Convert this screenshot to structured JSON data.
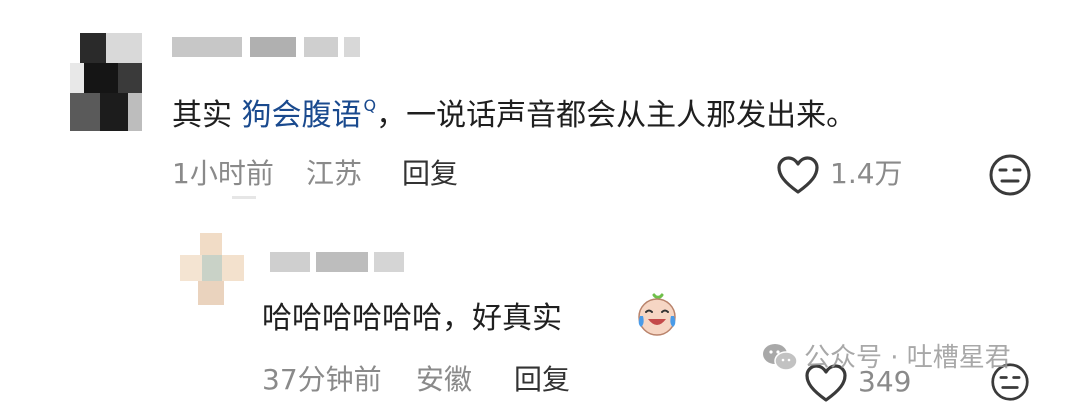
{
  "comment": {
    "prefix": "其实",
    "keyword": "狗会腹语",
    "keyword_marker": "Q",
    "suffix": "，一说话声音都会从主人那发出来。",
    "time": "1小时前",
    "location": "江苏",
    "reply_label": "回复",
    "like_count": "1.4万"
  },
  "reply": {
    "text": "哈哈哈哈哈哈，好真实",
    "time": "37分钟前",
    "location": "安徽",
    "reply_label": "回复",
    "like_count": "349"
  },
  "watermark": {
    "text": "公众号 · 吐槽星君"
  },
  "icons": {
    "like": "heart-outline-icon",
    "dislike": "neutral-face-icon",
    "emoji": "crying-laughing-emoji-icon",
    "wechat": "wechat-icon",
    "keyword_search": "search-icon"
  },
  "colors": {
    "text": "#1f1f1f",
    "meta": "#8a8a8a",
    "link": "#1a4a8e"
  }
}
